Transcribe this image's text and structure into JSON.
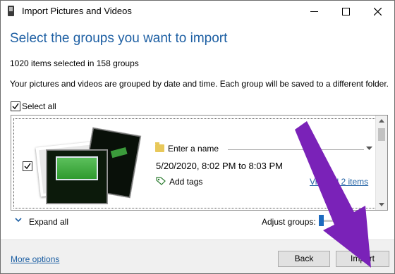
{
  "window": {
    "title": "Import Pictures and Videos"
  },
  "header": {
    "heading": "Select the groups you want to import",
    "selection_count": "1020 items selected in 158 groups",
    "description": "Your pictures and videos are grouped by date and time. Each group will be saved to a different folder."
  },
  "select_all": {
    "label": "Select all",
    "checked": true
  },
  "groups": [
    {
      "checked": true,
      "name_placeholder": "Enter a name",
      "date_range": "5/20/2020, 8:02 PM to 8:03 PM",
      "tags_label": "Add tags",
      "view_all_label": "View all 2 items"
    }
  ],
  "controls": {
    "expand_all_label": "Expand all",
    "adjust_groups_label": "Adjust groups:"
  },
  "footer": {
    "more_options_label": "More options",
    "back_label": "Back",
    "import_label": "Import"
  },
  "colors": {
    "accent": "#1d5fa3",
    "annotation_arrow": "#7a22b8"
  }
}
